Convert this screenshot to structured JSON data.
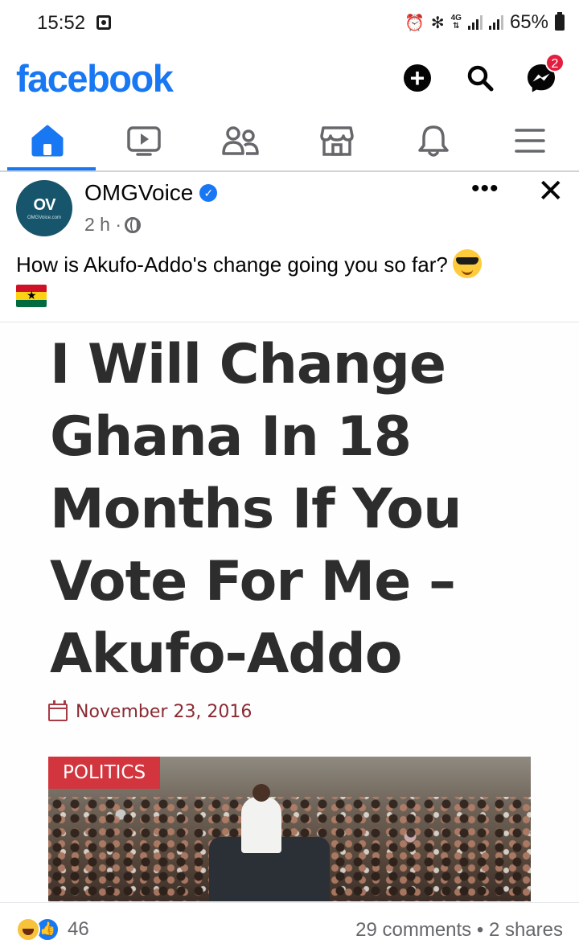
{
  "status_bar": {
    "time": "15:52",
    "network": "4G",
    "battery": "65%"
  },
  "header": {
    "logo": "facebook",
    "messenger_badge": "2",
    "brand_color": "#1877f2"
  },
  "nav": {
    "tabs": [
      {
        "name": "home",
        "active": true
      },
      {
        "name": "video",
        "active": false
      },
      {
        "name": "friends",
        "active": false
      },
      {
        "name": "marketplace",
        "active": false
      },
      {
        "name": "notifications",
        "active": false
      },
      {
        "name": "menu",
        "active": false
      }
    ]
  },
  "post": {
    "author": "OMGVoice",
    "time": "2 h ·",
    "more_label": "•••",
    "close_label": "✕",
    "text": "How is Akufo-Addo's change going you so far?",
    "avatar_text": "OV",
    "avatar_subtext": "OMGVoice.com"
  },
  "article": {
    "headline": "I Will Change Ghana In 18 Months If You Vote For Me – Akufo-Addo",
    "date": "November 23, 2016",
    "category_tag": "POLITICS"
  },
  "footer": {
    "reaction_count": "46",
    "comments": "29 comments",
    "separator": "•",
    "shares": "2 shares"
  }
}
